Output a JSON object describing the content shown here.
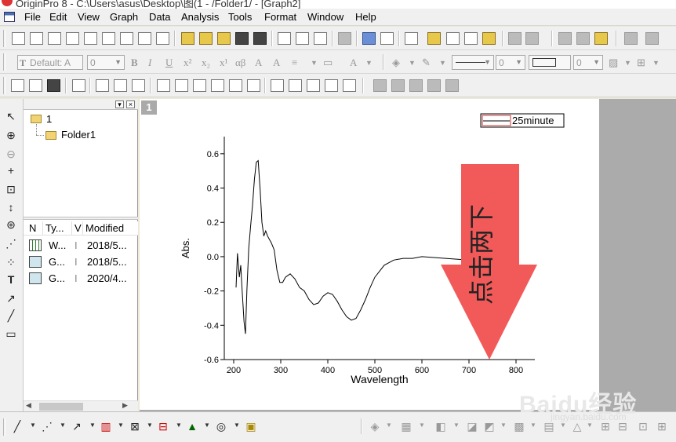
{
  "window": {
    "title": "OriginPro 8 - C:\\Users\\asus\\Desktop\\图(1 - /Folder1/ - [Graph2]"
  },
  "menu": [
    "File",
    "Edit",
    "View",
    "Graph",
    "Data",
    "Analysis",
    "Tools",
    "Format",
    "Window",
    "Help"
  ],
  "format_toolbar": {
    "font_name": "Default: A",
    "font_size": "0",
    "line_width": "0",
    "fill_width": "0"
  },
  "explorer": {
    "root_folder": "1",
    "subfolder": "Folder1",
    "columns": [
      "N",
      "Ty...",
      "V",
      "Modified"
    ],
    "rows": [
      {
        "name": "W...",
        "v": "I",
        "modified": "2018/5..."
      },
      {
        "name": "G...",
        "v": "I",
        "modified": "2018/5..."
      },
      {
        "name": "G...",
        "v": "I",
        "modified": "2020/4..."
      }
    ]
  },
  "graph": {
    "page_number": "1",
    "legend": "25minute",
    "annotation_text": "点击两下",
    "annotation_color": "#f25a5a"
  },
  "chart_data": {
    "type": "line",
    "xlabel": "Wavelength",
    "ylabel": "Abs.",
    "xlim": [
      180,
      840
    ],
    "ylim": [
      -0.6,
      0.7
    ],
    "xticks": [
      200,
      300,
      400,
      500,
      600,
      700,
      800
    ],
    "yticks": [
      -0.6,
      -0.4,
      -0.2,
      0.0,
      0.2,
      0.4,
      0.6
    ],
    "ytick_labels": [
      "-0.6",
      "-0.4",
      "-0.2",
      "0.0",
      "0.2",
      "0.4",
      "0.6"
    ],
    "series": [
      {
        "name": "25minute",
        "color": "#000000",
        "x": [
          205,
          208,
          212,
          215,
          218,
          222,
          225,
          228,
          232,
          236,
          240,
          244,
          248,
          252,
          256,
          260,
          264,
          268,
          272,
          276,
          280,
          286,
          292,
          298,
          304,
          310,
          320,
          330,
          340,
          350,
          360,
          370,
          380,
          390,
          400,
          410,
          420,
          430,
          440,
          450,
          460,
          470,
          480,
          490,
          500,
          520,
          540,
          560,
          580,
          600,
          650,
          700,
          750
        ],
        "y": [
          -0.18,
          0.02,
          -0.12,
          -0.05,
          -0.2,
          -0.38,
          -0.45,
          -0.2,
          0.05,
          0.18,
          0.3,
          0.45,
          0.55,
          0.56,
          0.4,
          0.2,
          0.12,
          0.15,
          0.12,
          0.1,
          0.08,
          0.04,
          -0.08,
          -0.15,
          -0.15,
          -0.12,
          -0.1,
          -0.13,
          -0.18,
          -0.2,
          -0.25,
          -0.28,
          -0.27,
          -0.23,
          -0.21,
          -0.22,
          -0.26,
          -0.31,
          -0.35,
          -0.37,
          -0.36,
          -0.31,
          -0.25,
          -0.18,
          -0.12,
          -0.05,
          -0.02,
          -0.01,
          -0.01,
          0.0,
          -0.01,
          -0.02,
          -0.02
        ]
      }
    ]
  },
  "watermark": {
    "text": "Baidu经验",
    "subtext": "jingyan.baidu.com"
  }
}
